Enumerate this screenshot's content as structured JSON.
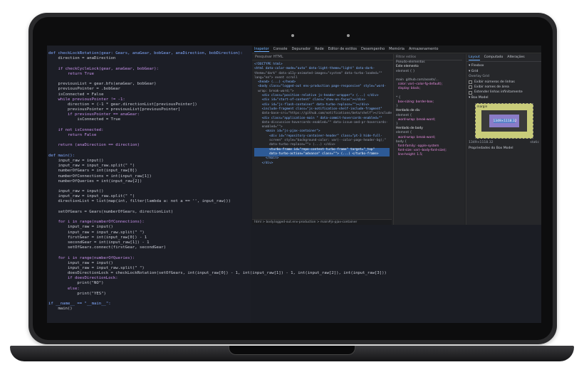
{
  "editor": {
    "lines": [
      "def checkLockRotation(gear: Gears, anaGear, bobGear, anaDirection, bobDirection):",
      "    direction = anaDirection",
      "",
      "    if checkCycleLock(gear, anaGear, bobGear):",
      "        return True",
      "",
      "    previousList = gear.bfs(anaGear, bobGear)",
      "    previousPointer = .bobGear",
      "    isConnected = False",
      "    while previousPointer != -1:",
      "        direction = (-1 * gear.directionList[previousPointer])",
      "        previousPointer = previousList[previousPointer]",
      "        if previousPointer == anaGear:",
      "            isConnected = True",
      "",
      "    if not isConnected:",
      "        return False",
      "",
      "    return (anaDirection == direction)",
      "",
      "def main():",
      "    input_raw = input()",
      "    input_raw = input_raw.split(\" \")",
      "    numberOfGears = int(input_raw[0])",
      "    numberOfConnections = int(input_raw[1])",
      "    numberOfQueries = int(input_raw[2])",
      "",
      "    input_raw = input()",
      "    input_raw = input_raw.split(\" \")",
      "    directionList = list(map(int, filter(lambda a: not a == '', input_raw)))",
      "",
      "    setOfGears = Gears(numberOfGears, directionList)",
      "",
      "    for i in range(numberOfConnections):",
      "        input_raw = input()",
      "        input_raw = input_raw.split(\" \")",
      "        firstGear = int(input_raw[0]) - 1",
      "        secondGear = int(input_raw[1]) - 1",
      "        setOfGears.connect(firstGear, secondGear)",
      "",
      "    for i in range(numberOfQueries):",
      "        input_raw = input()",
      "        input_raw = input_raw.split(\" \")",
      "        doesDirectionLock = checkLockRotation(setOfGears, int(input_raw[0]) - 1, int(input_raw[1]) - 1, int(input_raw[2]), int(input_raw[3]))",
      "        if doesDirectionLock:",
      "            print(\"NO\")",
      "        else:",
      "            print(\"YES\")",
      "",
      "if __name__ == \"__main__\":",
      "    main()"
    ]
  },
  "devtools": {
    "tabs": [
      "Inspetor",
      "Console",
      "Depurador",
      "Rede",
      "Editor de estilos",
      "Desempenho",
      "Memória",
      "Armazenamento"
    ],
    "active_tab": "Inspetor",
    "search_placeholder": "Pesquisar HTML",
    "html_lines": [
      "<!DOCTYPE html>",
      "<html data-color-mode=\"auto\" data-light-theme=\"light\" data-dark-",
      "theme=\"dark\" data-a11y-animated-images=\"system\" data-turbo-loaded=\"\"",
      "lang=\"en\"> event scroll",
      "  <head> (...) </head>",
      "  <body class=\"logged-out env-production page-responsive\" style=\"word-",
      "  wrap: break-word;\">",
      "    <div class=\"position-relative js-header-wrapper\"> (...) </div>",
      "    <div id=\"start-of-content\" class=\"show-on-focus\"></div>",
      "    <div id=\"js-flash-container\" data-turbo-replace=\"\"></div>",
      "    <include-fragment class=\"js-notification-shelf-include-fragment\"",
      "    data-base-src=\"https://github.com/notifications/beta/shelf\"></include",
      "    <div class=\"application-main \" data-commit-hovercards-enabled=\"\"",
      "    data-discussion-hovercards-enabled=\"\" data-issue-and-pr-hovercards-",
      "    enabled=\"\">",
      "      <main id=\"js-pjax-container\">",
      "        <div id=\"repository-container-header\" class=\"pt-3 hide-full-",
      "        screen\" style=\"background-color: var(--color-page-header-bg);\"",
      "        data-turbo-replace=\"\"> (...) </div>",
      "        <turbo-frame id=\"repo-content-turbo-frame\" target=\"_top\"",
      "        data-turbo-action=\"advance\" class=\"\"> (...) </turbo-frame>",
      "      </main>",
      "    </div>"
    ],
    "breadcrumb": "html > body.logged-out.env-production > main#js-pjax-container",
    "rules": {
      "filter_placeholder": "Filtrar estilos",
      "pseudo_label": "Pseudo-elementos",
      "this_element": "Este elemento",
      "lines": [
        "element { }",
        "",
        "main  github.com/assets/...",
        "  color: var(--color-fg-default);",
        "  display: block;",
        "",
        "* {",
        "  box-sizing: border-box;",
        "}",
        "Herdado de div",
        "element {",
        "  word-wrap: break-word;",
        "}",
        "Herdado de body",
        "element {",
        "  word-wrap: break-word;",
        "body {",
        "  font-family: -apple-system",
        "  font-size: var(--body-font-size);",
        "  line-height: 1.5;"
      ]
    },
    "layout": {
      "subtabs": [
        "Layout",
        "Computado",
        "Alterações"
      ],
      "active_subtab": "Layout",
      "flexbox_label": "Flexbox",
      "grid_label": "Grid",
      "overlay_grid_label": "Overlay Grid",
      "options": [
        "Exibir números de linhas",
        "Exibir nomes de área",
        "Estender linhas infinitamente"
      ],
      "box_model_label": "Box Model",
      "box_labels": {
        "margin": "margin",
        "border": "border",
        "padding": "padding",
        "content": "1349×1118.32"
      },
      "dims": "1349×1118.32",
      "position": "static",
      "props_label": "Propriedades do Box Model"
    }
  }
}
